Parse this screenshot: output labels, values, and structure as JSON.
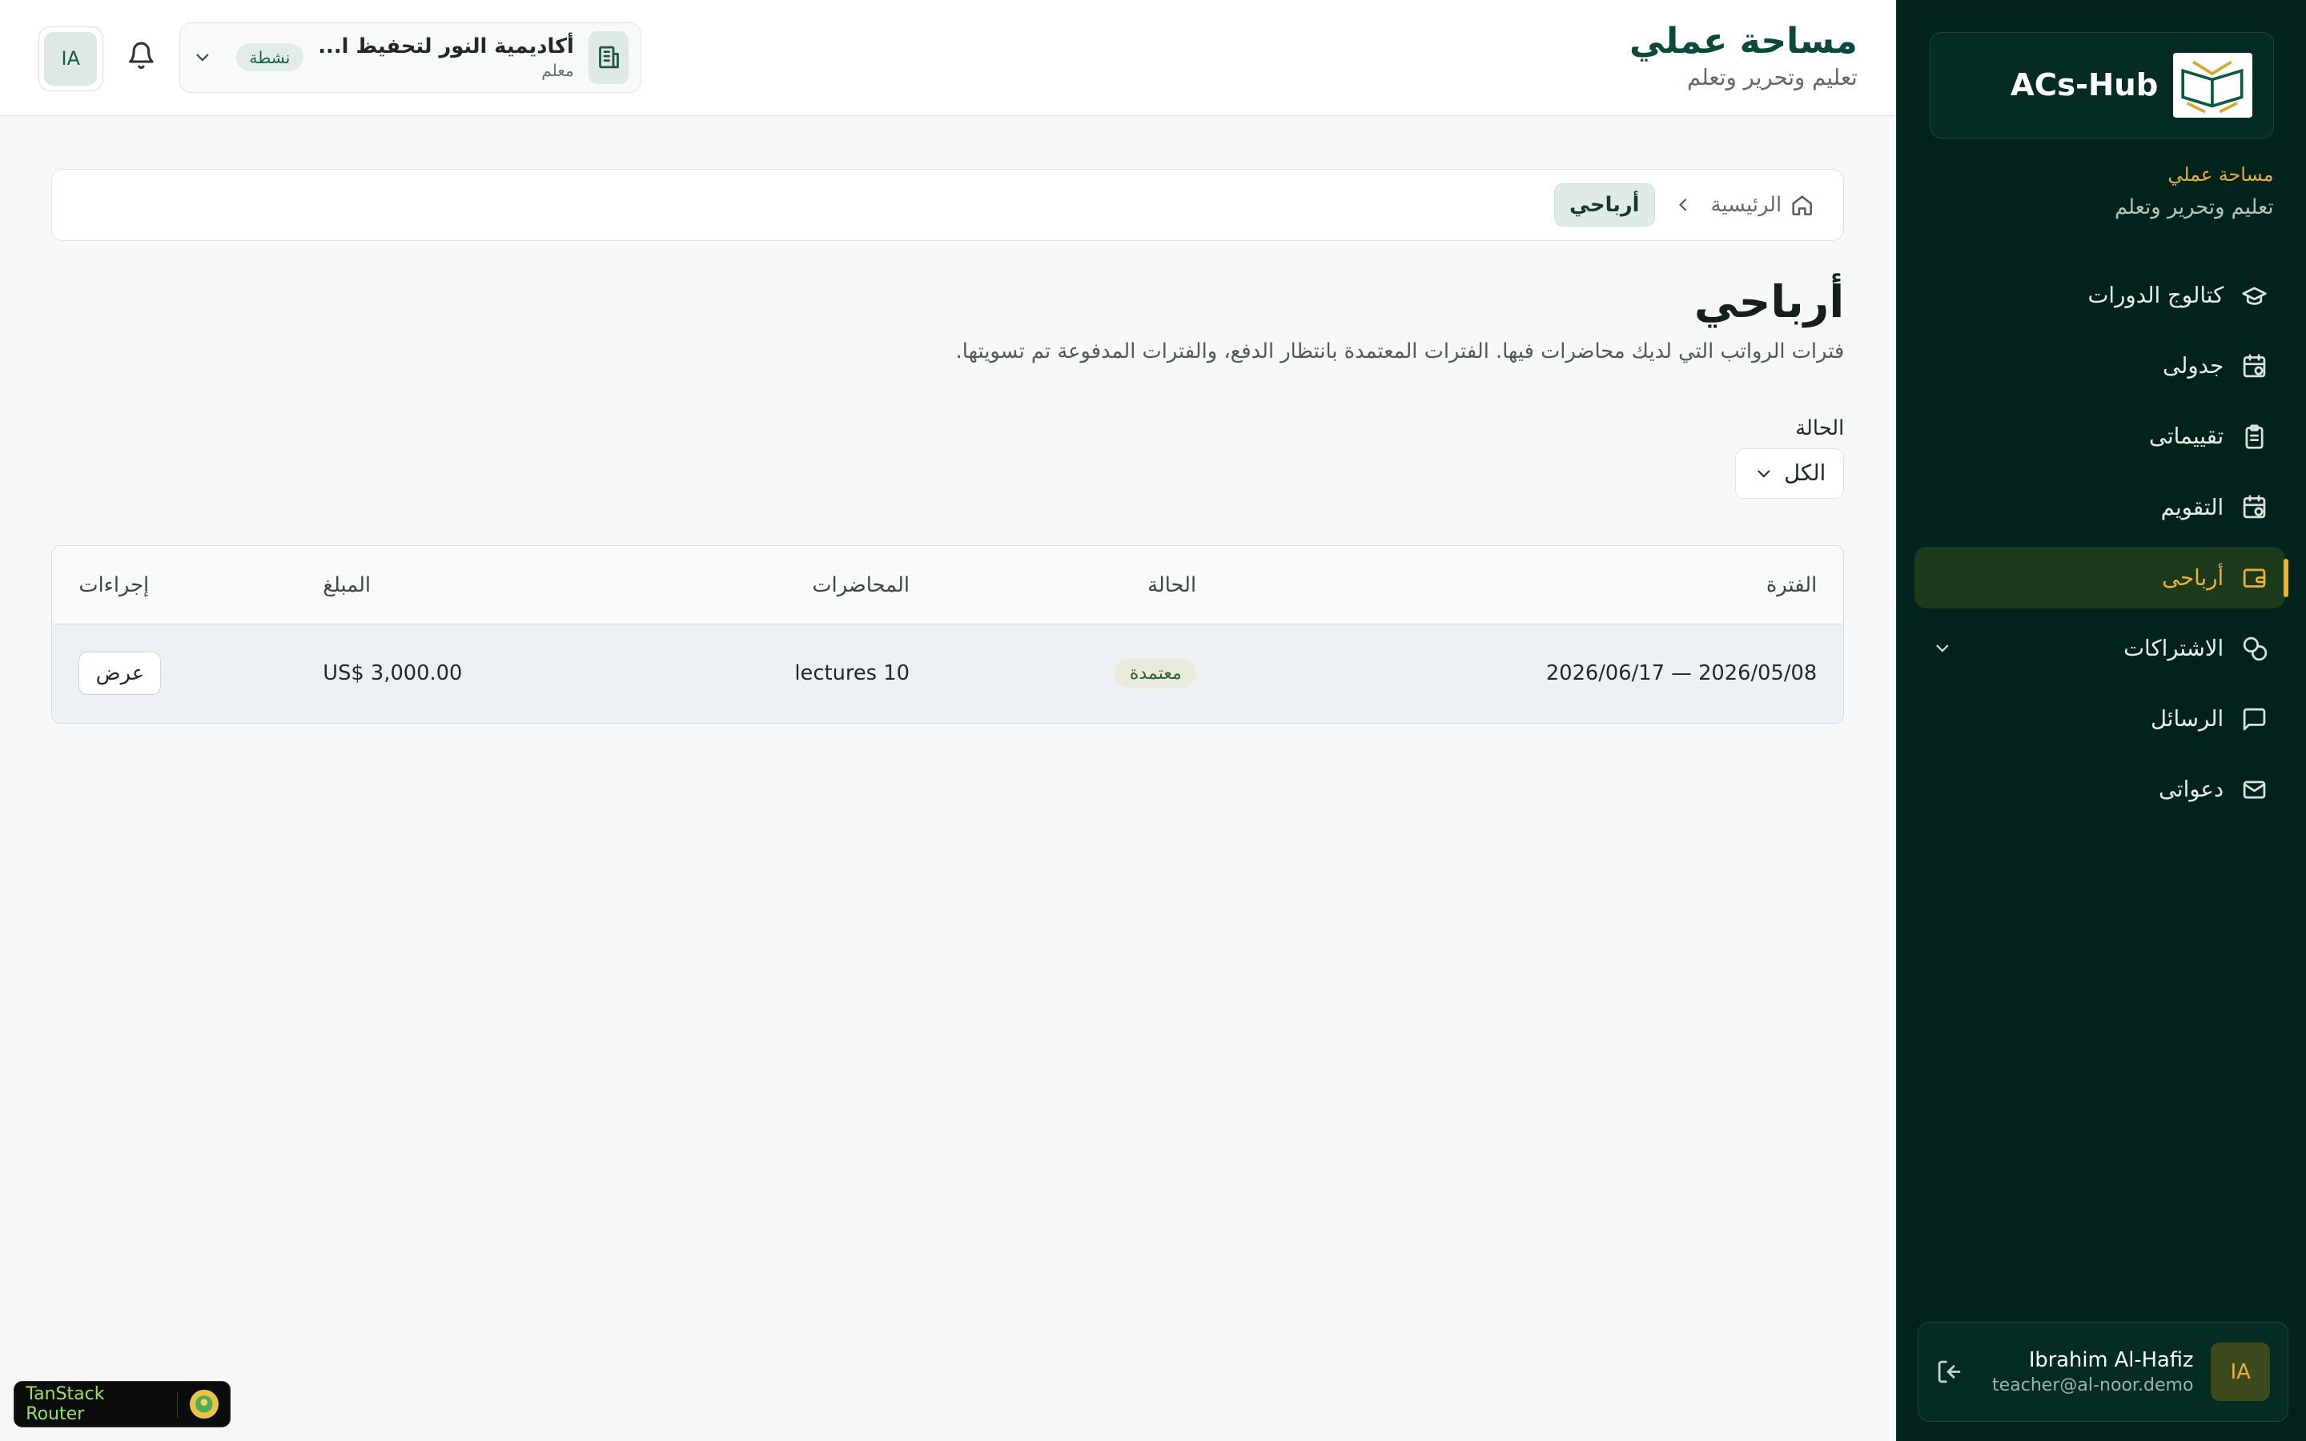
{
  "app": {
    "brand": "ACs-Hub",
    "workspace_label": "مساحة عملي",
    "workspace_sub": "تعليم وتحرير وتعلم"
  },
  "header": {
    "title": "مساحة عملي",
    "subtitle": "تعليم وتحرير وتعلم",
    "org": {
      "name": "أكاديمية النور لتحفيظ ا...",
      "role": "معلم",
      "status": "نشطة"
    },
    "avatar_initials": "IA"
  },
  "sidebar": {
    "items": [
      {
        "label": "كتالوج الدورات",
        "icon": "graduation-cap-icon"
      },
      {
        "label": "جدولى",
        "icon": "calendar-clock-icon"
      },
      {
        "label": "تقييماتى",
        "icon": "clipboard-list-icon"
      },
      {
        "label": "التقويم",
        "icon": "calendar-clock-icon"
      },
      {
        "label": "أرباحى",
        "icon": "wallet-icon",
        "active": true
      },
      {
        "label": "الاشتراكات",
        "icon": "coins-icon",
        "expandable": true
      },
      {
        "label": "الرسائل",
        "icon": "message-square-icon"
      },
      {
        "label": "دعواتى",
        "icon": "mail-icon"
      }
    ],
    "user": {
      "name": "Ibrahim Al-Hafiz",
      "email": "teacher@al-noor.demo",
      "initials": "IA"
    }
  },
  "breadcrumb": {
    "home": "الرئيسية",
    "current": "أرباحي"
  },
  "page": {
    "title": "أرباحي",
    "description": "فترات الرواتب التي لديك محاضرات فيها. الفترات المعتمدة بانتظار الدفع، والفترات المدفوعة تم تسويتها."
  },
  "filter": {
    "label": "الحالة",
    "value": "الكل"
  },
  "table": {
    "headers": {
      "period": "الفترة",
      "status": "الحالة",
      "lectures": "المحاضرات",
      "amount": "المبلغ",
      "actions": "إجراءات"
    },
    "rows": [
      {
        "period": "2026/05/08 — 2026/06/17",
        "status": "معتمدة",
        "lectures": "10 lectures",
        "amount": "US$ 3,000.00",
        "action": "عرض"
      }
    ]
  },
  "devtools": {
    "label": "TanStack Router"
  },
  "colors": {
    "sidebar_bg": "#02231b",
    "accent_gold": "#e8b33c",
    "brand_green": "#0b4a38"
  }
}
